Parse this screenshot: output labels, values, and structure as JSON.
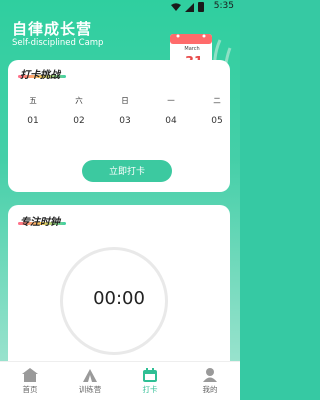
{
  "status_bar": {
    "time": "5:35"
  },
  "header": {
    "title": "自律成长营",
    "subtitle": "Self-disciplined Camp",
    "calendar_month": "March",
    "calendar_day": "31"
  },
  "checkin_card": {
    "title": "打卡挑战",
    "days": [
      {
        "name": "五",
        "num": "01"
      },
      {
        "name": "六",
        "num": "02"
      },
      {
        "name": "日",
        "num": "03"
      },
      {
        "name": "一",
        "num": "04"
      },
      {
        "name": "二",
        "num": "05"
      }
    ],
    "button_label": "立即打卡"
  },
  "focus_card": {
    "title": "专注时钟",
    "timer": "00:00"
  },
  "tabbar": {
    "items": [
      {
        "label": "首页",
        "icon": "home-icon",
        "active": false
      },
      {
        "label": "训练营",
        "icon": "tent-icon",
        "active": false
      },
      {
        "label": "打卡",
        "icon": "calendar-icon",
        "active": true
      },
      {
        "label": "我的",
        "icon": "user-icon",
        "active": false
      }
    ]
  },
  "colors": {
    "accent": "#3cc9a0",
    "header_bg": "#2fcf9f",
    "active_tab": "#2fbf94"
  }
}
